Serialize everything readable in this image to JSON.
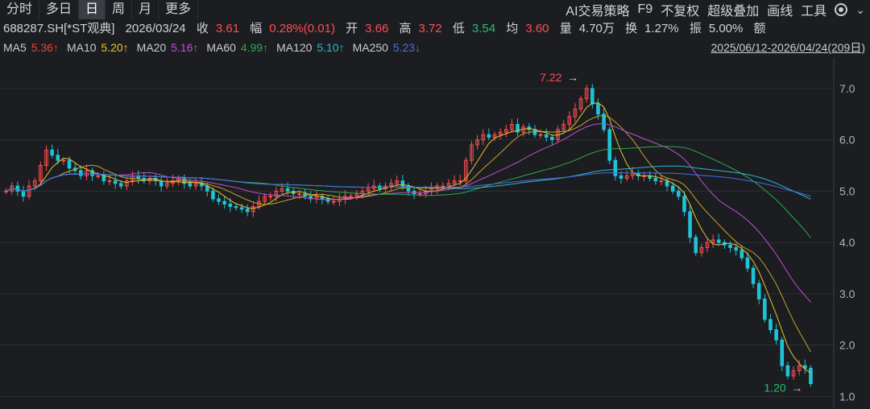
{
  "toolbar": {
    "period_tabs": [
      "分时",
      "多日",
      "日",
      "周",
      "月",
      "更多"
    ],
    "active": "日",
    "right_items": [
      "AI交易策略",
      "F9",
      "不复权",
      "超级叠加",
      "画线",
      "工具"
    ],
    "icons": [
      "gear-icon",
      "chevron-down-icon"
    ]
  },
  "quote": {
    "code": "688287.SH[*ST观典]",
    "date": "2026/03/24",
    "close_label": "收",
    "close": "3.61",
    "change_label": "幅",
    "change": "0.28%(0.01)",
    "open_label": "开",
    "open": "3.66",
    "high_label": "高",
    "high": "3.72",
    "low_label": "低",
    "low": "3.54",
    "avg_label": "均",
    "avg": "3.60",
    "volume_label": "量",
    "volume": "4.70万",
    "turnover_label": "换",
    "turnover": "1.27%",
    "amplitude_label": "振",
    "amplitude": "5.00%",
    "amount_label": "额"
  },
  "ma_legend": [
    {
      "label": "MA5",
      "value": "5.36↑",
      "color": "#e8443a"
    },
    {
      "label": "MA10",
      "value": "5.20↑",
      "color": "#e8c22e"
    },
    {
      "label": "MA20",
      "value": "5.16↑",
      "color": "#c04ed1"
    },
    {
      "label": "MA60",
      "value": "4.99↑",
      "color": "#2fa84f"
    },
    {
      "label": "MA120",
      "value": "5.10↑",
      "color": "#2fb7c9"
    },
    {
      "label": "MA250",
      "value": "5.23↓",
      "color": "#4a6fe0"
    }
  ],
  "date_range": "2025/06/12-2026/04/24(209日)",
  "colors": {
    "up": "#ff4d4f",
    "down": "#1fc3d6",
    "bg": "#1b1d21",
    "grid": "#2d3036"
  },
  "chart_data": {
    "type": "candlestick",
    "y_ticks": [
      "7.0",
      "6.0",
      "5.0",
      "4.0",
      "3.0",
      "2.0",
      "1.0"
    ],
    "ylim": [
      0.85,
      7.5
    ],
    "high_label": "7.22",
    "low_label": "1.20",
    "closes": [
      5.0,
      5.1,
      5.0,
      4.9,
      5.1,
      5.2,
      5.5,
      5.8,
      5.7,
      5.6,
      5.6,
      5.45,
      5.4,
      5.3,
      5.4,
      5.3,
      5.3,
      5.2,
      5.2,
      5.15,
      5.1,
      5.2,
      5.3,
      5.25,
      5.2,
      5.25,
      5.2,
      5.1,
      5.15,
      5.2,
      5.25,
      5.15,
      5.1,
      5.15,
      5.1,
      5.0,
      4.85,
      4.8,
      4.75,
      4.7,
      4.68,
      4.65,
      4.6,
      4.7,
      4.8,
      4.9,
      4.9,
      5.0,
      5.05,
      5.0,
      4.95,
      4.95,
      4.9,
      4.85,
      4.9,
      4.85,
      4.8,
      4.8,
      4.85,
      4.9,
      4.9,
      4.95,
      5.0,
      5.05,
      5.1,
      5.05,
      5.1,
      5.15,
      5.2,
      5.1,
      5.0,
      4.95,
      4.95,
      5.0,
      5.05,
      5.1,
      5.1,
      5.15,
      5.2,
      5.2,
      5.6,
      5.9,
      6.0,
      6.1,
      6.05,
      6.1,
      6.15,
      6.2,
      6.3,
      6.15,
      6.25,
      6.2,
      6.1,
      6.1,
      6.05,
      6.0,
      6.2,
      6.3,
      6.45,
      6.6,
      6.8,
      7.0,
      6.7,
      6.5,
      6.2,
      5.6,
      5.3,
      5.25,
      5.3,
      5.35,
      5.3,
      5.3,
      5.25,
      5.2,
      5.2,
      5.1,
      5.0,
      4.9,
      4.6,
      4.1,
      3.8,
      3.9,
      4.0,
      4.05,
      4.0,
      3.95,
      3.9,
      3.85,
      3.7,
      3.5,
      3.2,
      2.9,
      2.5,
      2.3,
      2.1,
      1.6,
      1.4,
      1.5,
      1.6,
      1.55,
      1.25
    ]
  }
}
